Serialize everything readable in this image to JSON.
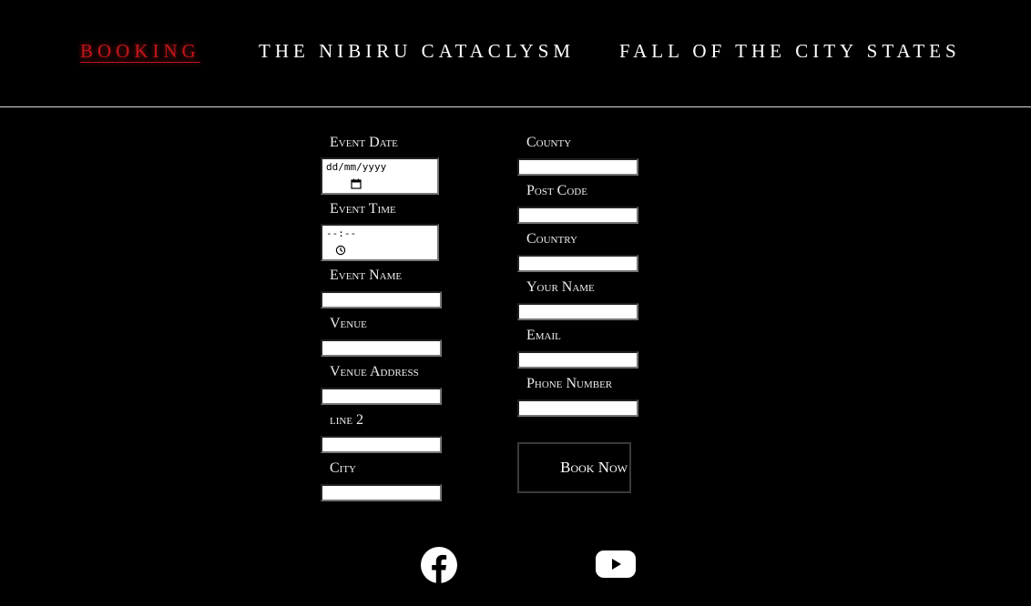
{
  "nav": {
    "items": [
      {
        "label": "BOOKING",
        "active": true
      },
      {
        "label": "THE NIBIRU CATACLYSM",
        "active": false
      },
      {
        "label": "FALL OF THE CITY STATES",
        "active": false
      }
    ],
    "active_color": "#c0141a"
  },
  "form": {
    "left": {
      "event_date": {
        "label": "Event Date",
        "placeholder": "dd/mm/yyyy"
      },
      "event_time": {
        "label": "Event Time",
        "placeholder": "--:--"
      },
      "event_name": {
        "label": "Event Name"
      },
      "venue": {
        "label": "Venue"
      },
      "venue_address": {
        "label": "Venue Address"
      },
      "line2": {
        "label": "line 2"
      },
      "city": {
        "label": "City"
      }
    },
    "right": {
      "county": {
        "label": "County"
      },
      "post_code": {
        "label": "Post Code"
      },
      "country": {
        "label": "Country"
      },
      "your_name": {
        "label": "Your Name"
      },
      "email": {
        "label": "Email"
      },
      "phone": {
        "label": "Phone Number"
      }
    },
    "submit_label": "Book Now"
  },
  "social": {
    "facebook_icon": "facebook-icon",
    "youtube_icon": "youtube-icon"
  }
}
